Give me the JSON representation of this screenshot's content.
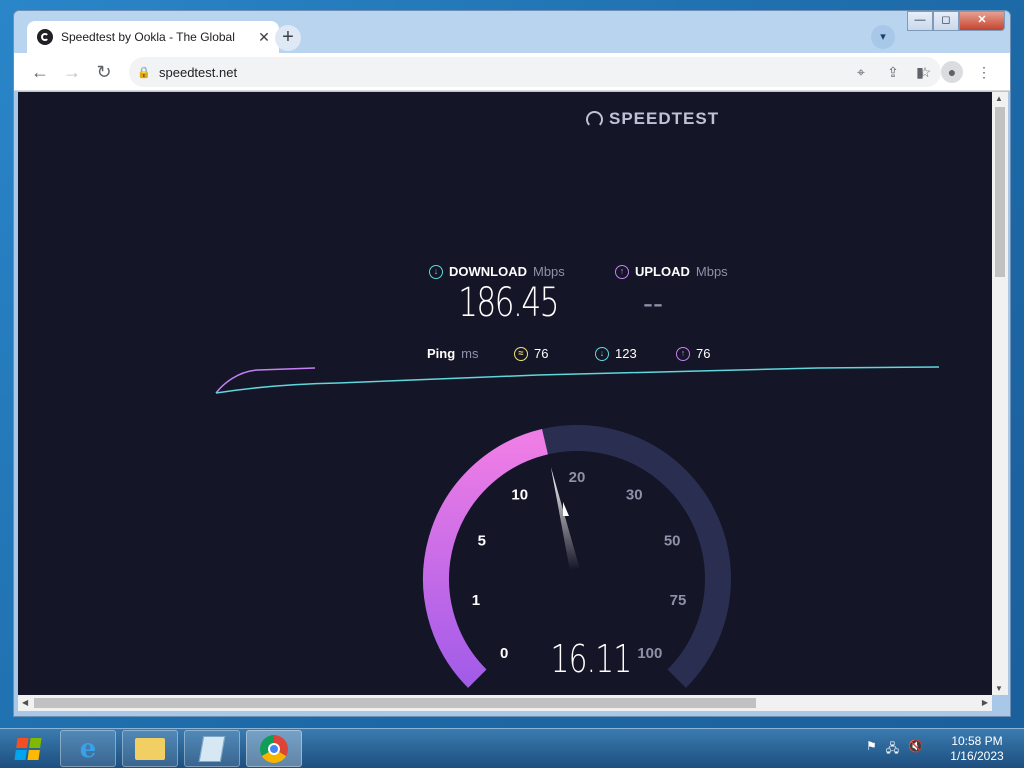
{
  "browser": {
    "tab_title": "Speedtest by Ookla - The Global",
    "url": "speedtest.net",
    "window_controls": {
      "minimize": "—",
      "maximize": "◻",
      "close": "✕"
    }
  },
  "page": {
    "brand": "SPEEDTEST",
    "download": {
      "label": "DOWNLOAD",
      "unit": "Mbps",
      "value": "186.45"
    },
    "upload": {
      "label": "UPLOAD",
      "unit": "Mbps",
      "value": "--"
    },
    "ping": {
      "label": "Ping",
      "unit": "ms",
      "idle": "76",
      "download": "123",
      "upload": "76"
    },
    "gauge": {
      "reading": "16.11",
      "reading_value": 16.11,
      "ticks": [
        {
          "label": "0",
          "value": 0
        },
        {
          "label": "1",
          "value": 1
        },
        {
          "label": "5",
          "value": 5
        },
        {
          "label": "10",
          "value": 10
        },
        {
          "label": "20",
          "value": 20
        },
        {
          "label": "30",
          "value": 30
        },
        {
          "label": "50",
          "value": 50
        },
        {
          "label": "75",
          "value": 75
        },
        {
          "label": "100",
          "value": 100
        }
      ]
    }
  },
  "colors": {
    "bg": "#141526",
    "download": "#5fd7dc",
    "upload": "#c580f3",
    "ping": "#f3e27a",
    "gauge_fill_top": "#ef7de6",
    "gauge_fill_bottom": "#a35ce8",
    "gauge_track": "#2a2f52"
  },
  "taskbar": {
    "time": "10:58 PM",
    "date": "1/16/2023"
  }
}
